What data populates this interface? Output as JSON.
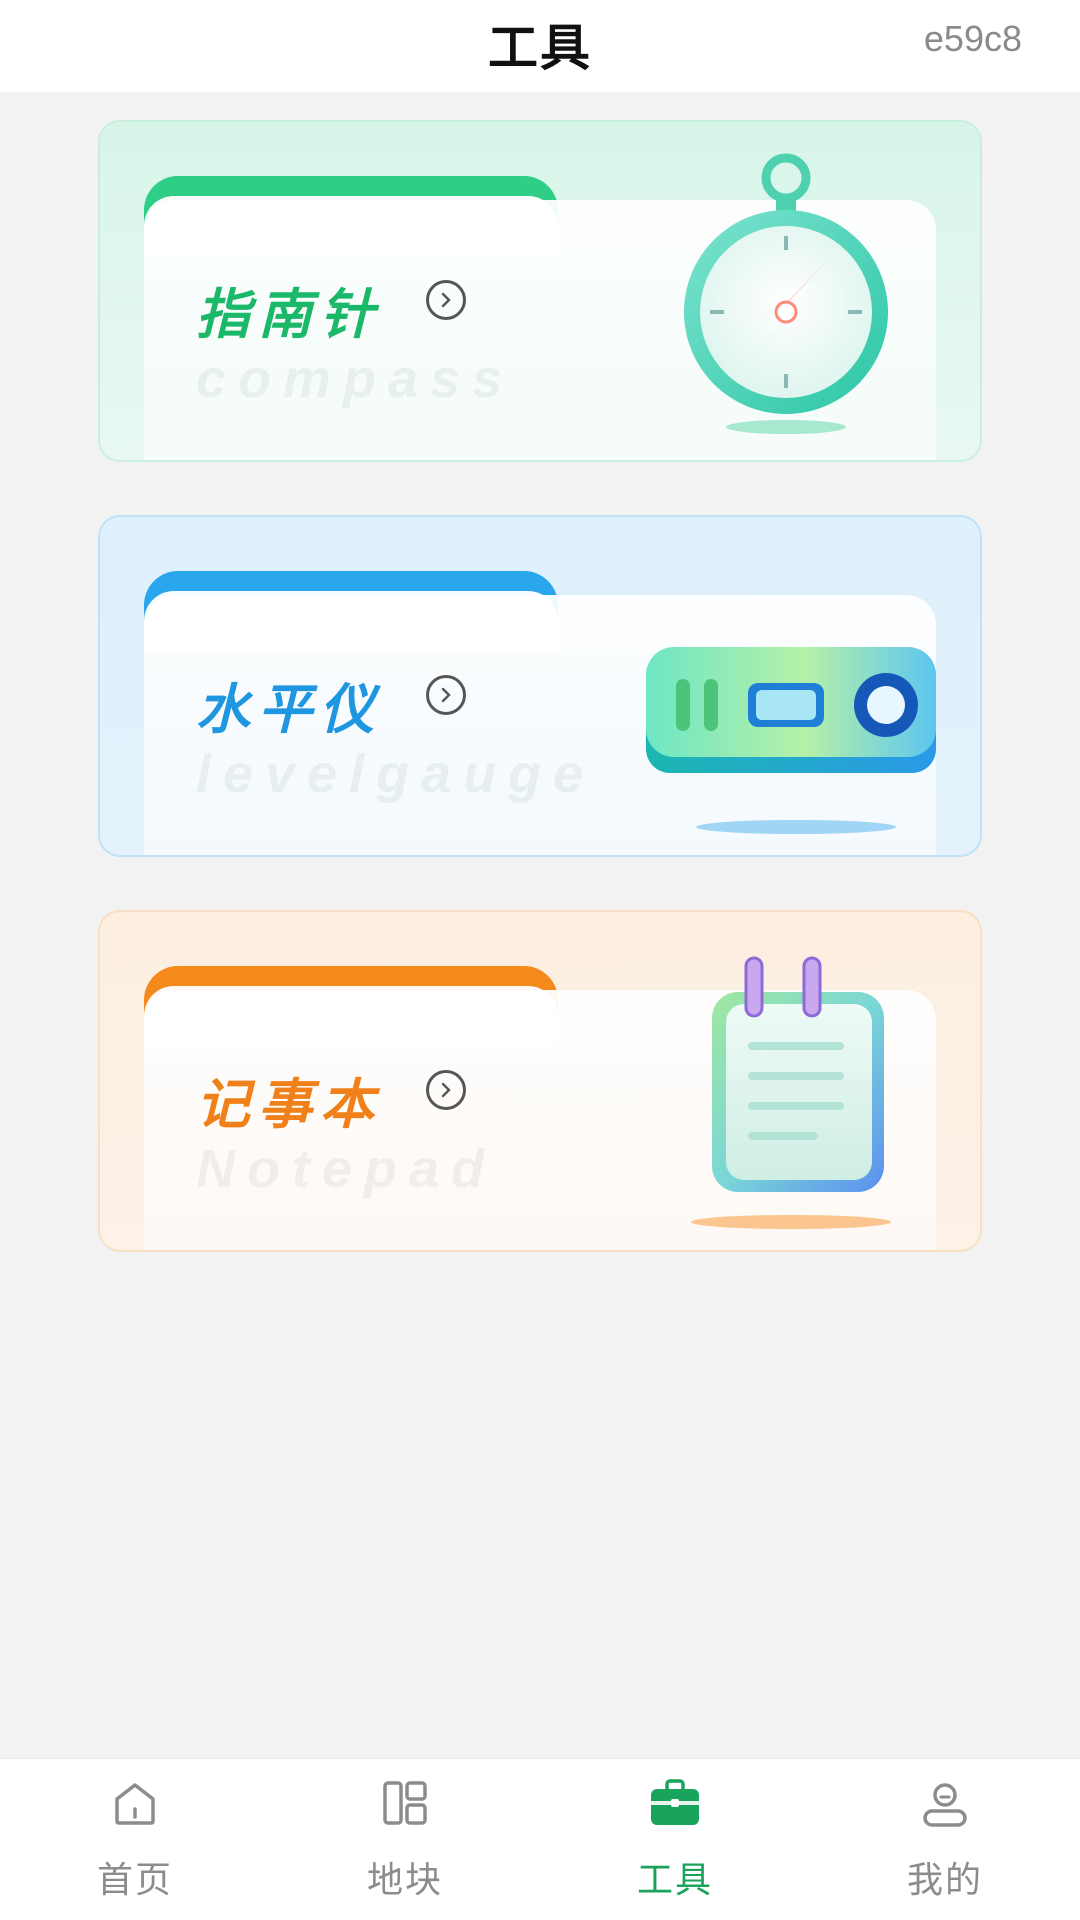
{
  "header": {
    "title": "工具",
    "code": "e59c8"
  },
  "tools": [
    {
      "name": "指南针",
      "subtitle": "compass",
      "accent": "#2fce86",
      "icon": "compass-icon"
    },
    {
      "name": "水平仪",
      "subtitle": "levelgauge",
      "accent": "#2aa6ee",
      "icon": "level-gauge-icon"
    },
    {
      "name": "记事本",
      "subtitle": "Notepad",
      "accent": "#f58a1c",
      "icon": "notepad-icon"
    }
  ],
  "tabbar": {
    "items": [
      {
        "label": "首页",
        "icon": "home-icon"
      },
      {
        "label": "地块",
        "icon": "plots-icon"
      },
      {
        "label": "工具",
        "icon": "toolbox-icon",
        "active": true
      },
      {
        "label": "我的",
        "icon": "profile-icon"
      }
    ],
    "active_color": "#1aa35a"
  }
}
